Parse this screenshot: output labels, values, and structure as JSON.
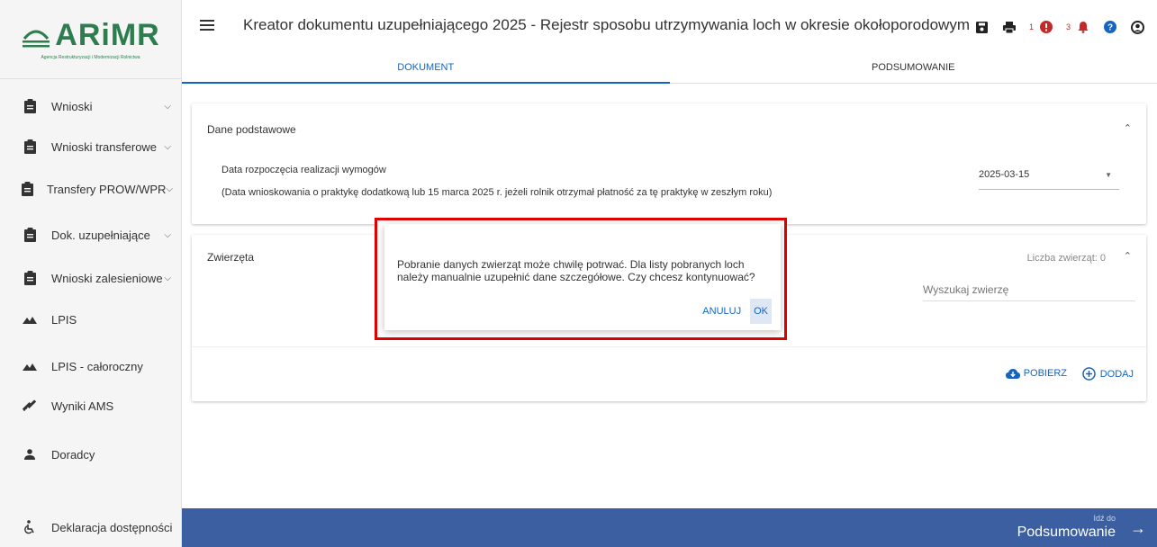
{
  "logo": {
    "text": "ARiMR",
    "subtitle": "Agencja Restrukturyzacji i Modernizacji Rolnictwa"
  },
  "sidebar": {
    "items": [
      {
        "label": "Wnioski",
        "icon": "clipboard-icon",
        "has_chevron": true
      },
      {
        "label": "Wnioski transferowe",
        "icon": "clipboard-icon",
        "has_chevron": true
      },
      {
        "label": "Transfery PROW/WPR",
        "icon": "clipboard-icon",
        "has_chevron": true
      },
      {
        "label": "Dok. uzupełniające",
        "icon": "clipboard-icon",
        "has_chevron": true
      },
      {
        "label": "Wnioski zalesieniowe",
        "icon": "clipboard-icon",
        "has_chevron": true
      },
      {
        "label": "LPIS",
        "icon": "terrain-icon",
        "has_chevron": false
      },
      {
        "label": "LPIS - całoroczny",
        "icon": "terrain-icon",
        "has_chevron": false
      },
      {
        "label": "Wyniki AMS",
        "icon": "satellite-icon",
        "has_chevron": false
      },
      {
        "label": "Doradcy",
        "icon": "person-icon",
        "has_chevron": false
      }
    ],
    "accessibility": "Deklaracja dostępności"
  },
  "header": {
    "title": "Kreator dokumentu uzupełniającego 2025 - Rejestr sposobu utrzymywania loch w okresie okołoporodowym",
    "error_count": "1",
    "notification_count": "3",
    "tabs": [
      "DOKUMENT",
      "PODSUMOWANIE"
    ]
  },
  "basic": {
    "title": "Dane podstawowe",
    "label": "Data rozpoczęcia realizacji wymogów",
    "hint": "(Data wnioskowania o praktykę dodatkową lub 15 marca 2025 r. jeżeli rolnik otrzymał płatność za tę praktykę w zeszłym roku)",
    "date": "2025-03-15"
  },
  "animals": {
    "title": "Zwierzęta",
    "count_label": "Liczba zwierząt: 0",
    "search_placeholder": "Wyszukaj zwierzę",
    "download_label": "POBIERZ",
    "add_label": "DODAJ"
  },
  "footer": {
    "sub": "Idź do",
    "main": "Podsumowanie"
  },
  "dialog": {
    "message": "Pobranie danych zwierząt może chwilę potrwać. Dla listy pobranych loch należy manualnie uzupełnić dane szczegółowe. Czy chcesz kontynuować?",
    "cancel": "ANULUJ",
    "ok": "OK"
  },
  "colors": {
    "brand": "#2e7d4f",
    "primary": "#1565c0",
    "footer": "#3b5fa0",
    "highlight": "#e00000",
    "alert": "#c62828"
  }
}
